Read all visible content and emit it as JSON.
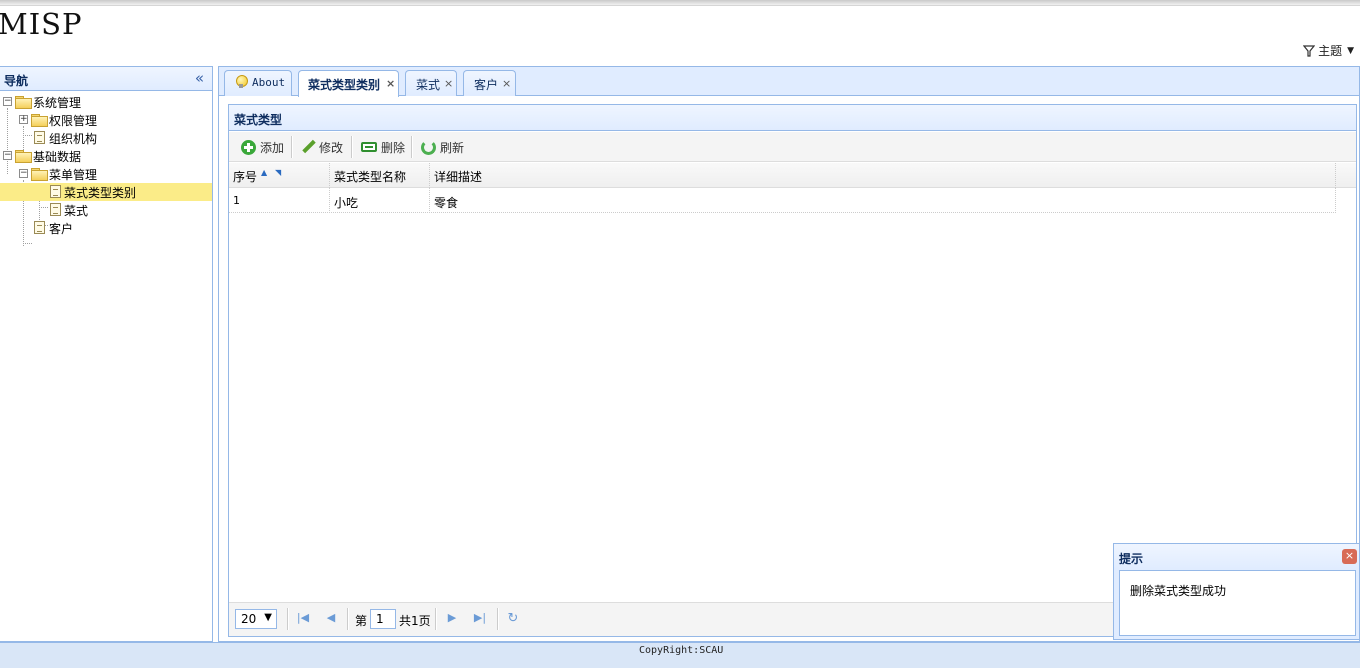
{
  "app": {
    "title": "MISP",
    "theme_label": "主题",
    "footer": "CopyRight:SCAU"
  },
  "nav": {
    "title": "导航",
    "collapse_icon": "double-chevron-left-icon",
    "items": [
      {
        "label": "系统管理"
      },
      {
        "label": "权限管理"
      },
      {
        "label": "组织机构"
      },
      {
        "label": "基础数据"
      },
      {
        "label": "菜单管理"
      },
      {
        "label": "菜式类型类别",
        "selected": true
      },
      {
        "label": "菜式"
      },
      {
        "label": "客户"
      }
    ]
  },
  "tabs": [
    {
      "label": "About",
      "closable": false
    },
    {
      "label": "菜式类型类别",
      "closable": true,
      "active": true
    },
    {
      "label": "菜式",
      "closable": true
    },
    {
      "label": "客户",
      "closable": true
    }
  ],
  "close_glyph": "×",
  "panel": {
    "title": "菜式类型",
    "toolbar": {
      "add": "添加",
      "edit": "修改",
      "delete": "删除",
      "refresh": "刷新"
    },
    "columns": [
      "序号",
      "菜式类型名称",
      "详细描述"
    ],
    "rows": [
      [
        "1",
        "小吃",
        "零食"
      ]
    ],
    "pager": {
      "page_size": "20",
      "page_prefix": "第",
      "page_number": "1",
      "page_suffix": "共1页"
    }
  },
  "message": {
    "title": "提示",
    "text": "删除菜式类型成功",
    "close_glyph": "×"
  },
  "colors": {
    "border": "#95b8e7",
    "header_bg": "#e0ecff",
    "selected_bg": "#fbec88",
    "footer_bg": "#d9e6f7"
  }
}
